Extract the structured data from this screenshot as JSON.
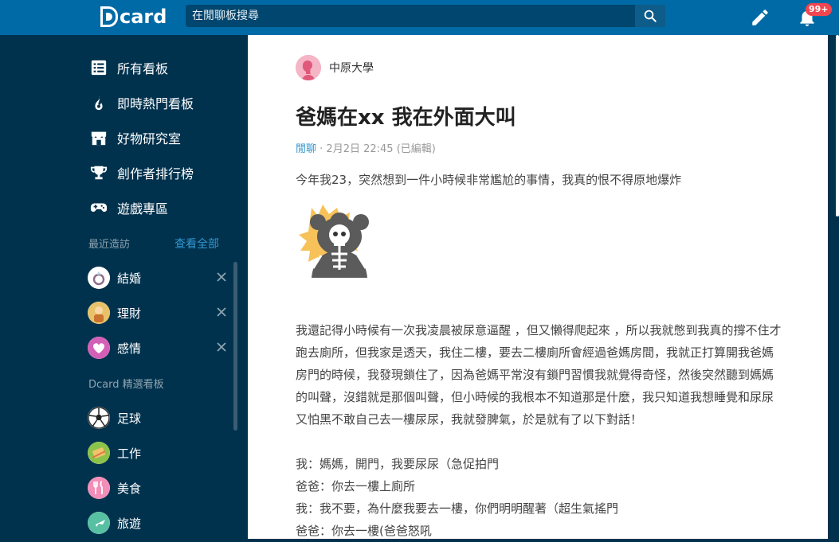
{
  "app": {
    "logo_text": "card"
  },
  "search": {
    "placeholder": "在閒聊板搜尋"
  },
  "header": {
    "notification_count": "99+"
  },
  "sidebar": {
    "nav": [
      {
        "label": "所有看板",
        "icon": "list-icon"
      },
      {
        "label": "即時熱門看板",
        "icon": "flame-icon"
      },
      {
        "label": "好物研究室",
        "icon": "store-icon"
      },
      {
        "label": "創作者排行榜",
        "icon": "trophy-icon"
      },
      {
        "label": "遊戲專區",
        "icon": "gamepad-icon"
      }
    ],
    "recent_label": "最近造訪",
    "see_all": "查看全部",
    "recent": [
      {
        "label": "結婚",
        "icon": "ring-icon"
      },
      {
        "label": "理財",
        "icon": "money-icon"
      },
      {
        "label": "感情",
        "icon": "heart-icon"
      }
    ],
    "featured_label": "Dcard 精選看板",
    "featured": [
      {
        "label": "足球",
        "icon": "soccer-icon"
      },
      {
        "label": "工作",
        "icon": "work-icon"
      },
      {
        "label": "美食",
        "icon": "food-icon"
      },
      {
        "label": "旅遊",
        "icon": "plane-icon"
      }
    ]
  },
  "post": {
    "author": "中原大學",
    "title": "爸媽在xx 我在外面大叫",
    "forum": "閒聊",
    "time": "2月2日 22:45 (已編輯)",
    "intro": "今年我23，突然想到一件小時候非常尷尬的事情，我真的恨不得原地爆炸",
    "body": "我還記得小時候有一次我凌晨被尿意逼醒 ，但又懶得爬起來 ，所以我就憋到我真的撐不住才跑去廁所，但我家是透天，我住二樓，要去二樓廁所會經過爸媽房間，我就正打算開我爸媽房門的時候，我發現鎖住了，因為爸媽平常沒有鎖門習慣我就覺得奇怪，然後突然聽到媽媽的叫聲，沒錯就是那個叫聲，但小時候的我根本不知道那是什麼，我只知道我想睡覺和尿尿又怕黑不敢自己去一樓尿尿，我就發脾氣，於是就有了以下對話！",
    "dialogue": [
      "我：媽媽，開門，我要尿尿（急促拍門",
      "爸爸：你去一樓上廁所",
      "我：我不要，為什麼我要去一樓，你們明明醒著（超生氣搖門",
      "爸爸：你去一樓(爸爸怒吼"
    ]
  },
  "colors": {
    "topbar": "#006aa6",
    "sidebar": "#00324e",
    "accent": "#3397cf",
    "badge": "#f14550"
  }
}
